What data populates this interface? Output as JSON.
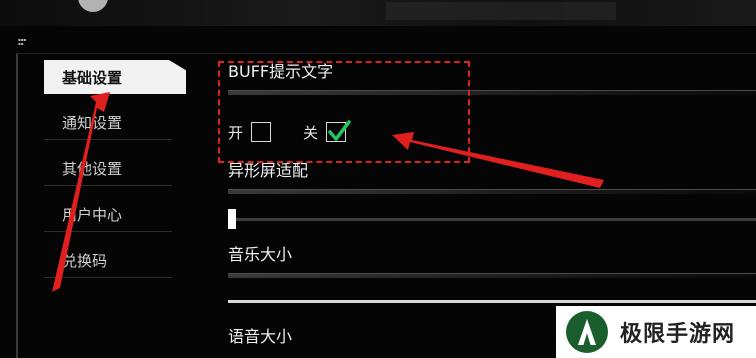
{
  "sidebar": {
    "items": [
      {
        "label": "基础设置",
        "active": true
      },
      {
        "label": "通知设置",
        "active": false
      },
      {
        "label": "其他设置",
        "active": false
      },
      {
        "label": "用户中心",
        "active": false
      },
      {
        "label": "兑换码",
        "active": false
      }
    ]
  },
  "settings": {
    "buff_text": {
      "title": "BUFF提示文字",
      "on_label": "开",
      "off_label": "关",
      "selected": "关"
    },
    "screen_adapt": {
      "title": "异形屏适配",
      "value": 0
    },
    "music_volume": {
      "title": "音乐大小"
    },
    "voice_volume": {
      "title": "语音大小"
    }
  },
  "watermark": {
    "text": "极限手游网"
  },
  "colors": {
    "background": "#050505",
    "highlight": "#dd2222",
    "check": "#22c55e",
    "active_tab": "#f2f2f2",
    "watermark_logo": "#1b5e2e"
  }
}
